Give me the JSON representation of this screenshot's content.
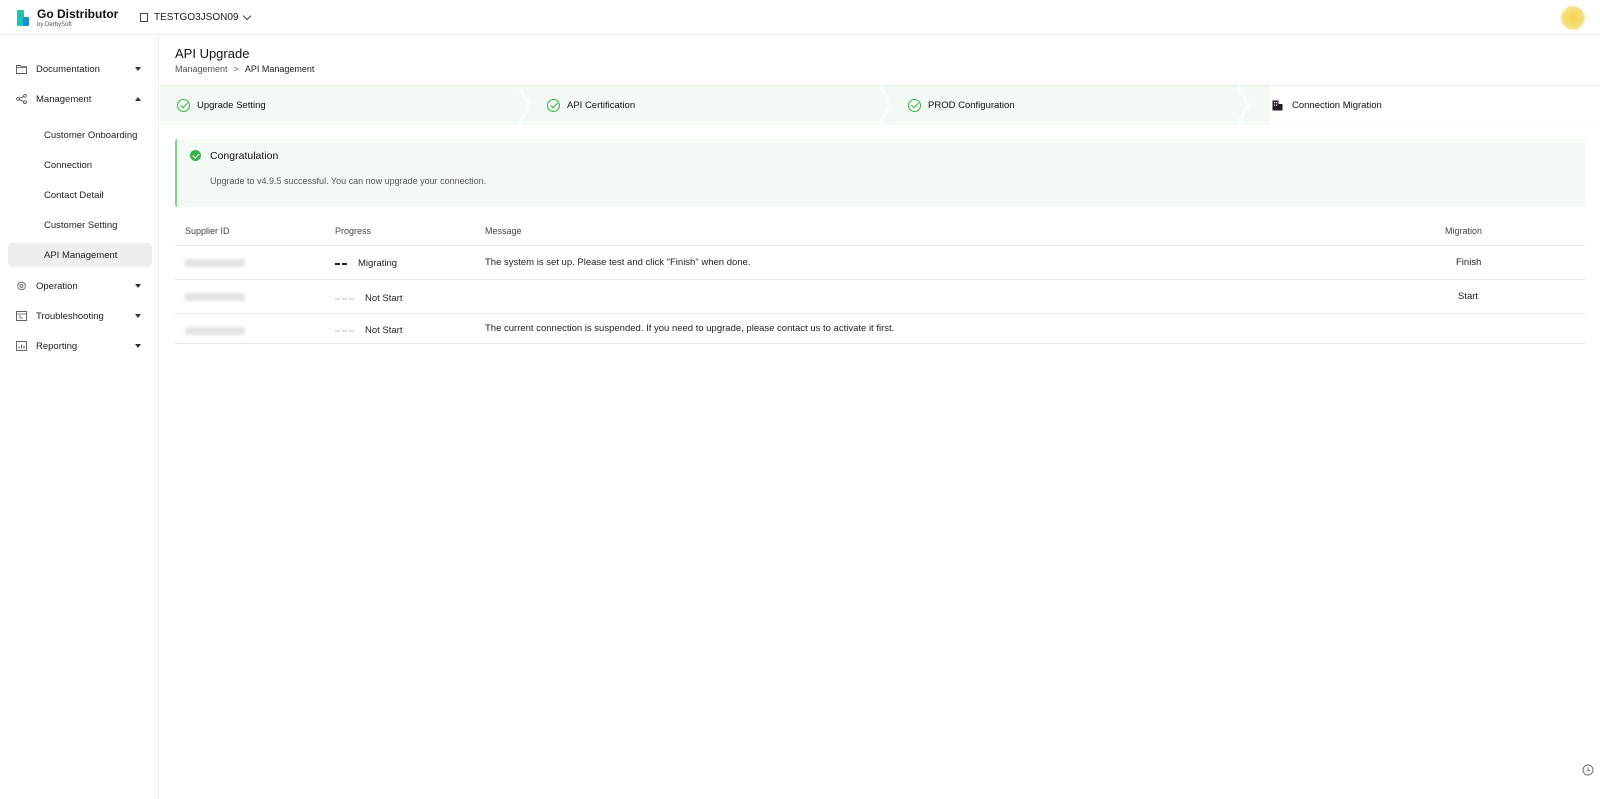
{
  "app": {
    "name": "Go Distributor",
    "by": "by DerbySoft",
    "tenant": "TESTGO3JSON09"
  },
  "sidebar": {
    "documentation": "Documentation",
    "management": "Management",
    "management_items": [
      "Customer Onboarding",
      "Connection",
      "Contact Detail",
      "Customer Setting",
      "API Management"
    ],
    "operation": "Operation",
    "troubleshooting": "Troubleshooting",
    "reporting": "Reporting"
  },
  "page": {
    "title": "API Upgrade",
    "breadcrumb": [
      "Management",
      ">",
      "API Management"
    ]
  },
  "steps": [
    {
      "label": "Upgrade Setting",
      "status": "done"
    },
    {
      "label": "API Certification",
      "status": "done"
    },
    {
      "label": "PROD Configuration",
      "status": "done"
    },
    {
      "label": "Connection Migration",
      "status": "current"
    }
  ],
  "alert": {
    "title": "Congratulation",
    "message": "Upgrade to v4.9.5 successful. You can now upgrade your connection."
  },
  "table": {
    "headers": {
      "supplier_id": "Supplier ID",
      "progress": "Progress",
      "message": "Message",
      "migration": "Migration"
    },
    "rows": [
      {
        "progress": "Migrating",
        "message": "The system is set up. Please test and click \"Finish\" when done.",
        "action": "Finish"
      },
      {
        "progress": "Not Start",
        "message": "",
        "action": "Start"
      },
      {
        "progress": "Not Start",
        "message": "The current connection is suspended. If you need to upgrade, please contact us to activate it first.",
        "action": ""
      }
    ]
  },
  "colors": {
    "success": "#34b24b",
    "step_bg": "#f3f9f3",
    "active_nav": "#eeeeee"
  }
}
